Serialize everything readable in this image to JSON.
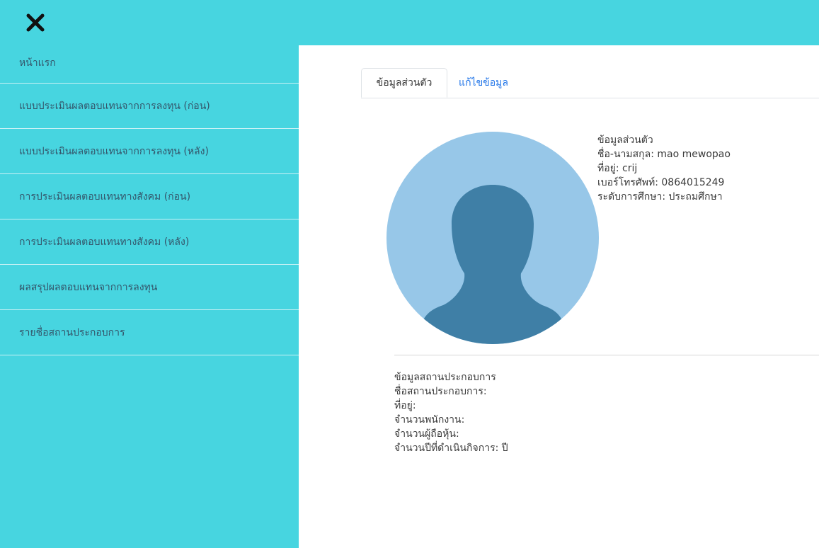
{
  "header": {
    "close_icon": "close-icon"
  },
  "sidebar": {
    "items": [
      {
        "label": "หน้าแรก"
      },
      {
        "label": "แบบประเมินผลตอบแทนจากการลงทุน (ก่อน)"
      },
      {
        "label": "แบบประเมินผลตอบแทนจากการลงทุน (หลัง)"
      },
      {
        "label": "การประเมินผลตอบแทนทางสังคม (ก่อน)"
      },
      {
        "label": "การประเมินผลตอบแทนทางสังคม (หลัง)"
      },
      {
        "label": "ผลสรุปผลตอบแทนจากการลงทุน"
      },
      {
        "label": "รายชื่อสถานประกอบการ"
      }
    ]
  },
  "tabs": [
    {
      "label": "ข้อมูลส่วนตัว",
      "active": true
    },
    {
      "label": "แก้ไขข้อมูล",
      "active": false
    }
  ],
  "personal": {
    "heading": "ข้อมูลส่วนตัว",
    "name": "ชื่อ-นามสกุล: mao mewopao",
    "address": "ที่อยู่: crij",
    "phone": "เบอร์โทรศัพท์: 0864015249",
    "education": "ระดับการศึกษา: ประถมศึกษา"
  },
  "business": {
    "heading": "ข้อมูลสถานประกอบการ",
    "name": "ชื่อสถานประกอบการ:",
    "address": "ที่อยู่:",
    "employees": "จำนวนพนักงาน:",
    "shareholders": "จำนวนผู้ถือหุ้น:",
    "years": "จำนวนปีที่ดำเนินกิจการ: ปี"
  },
  "colors": {
    "accent": "#47d5e0",
    "link": "#1e73e8",
    "avatar_bg": "#97c7e8",
    "avatar_fg": "#3f7fa6"
  }
}
